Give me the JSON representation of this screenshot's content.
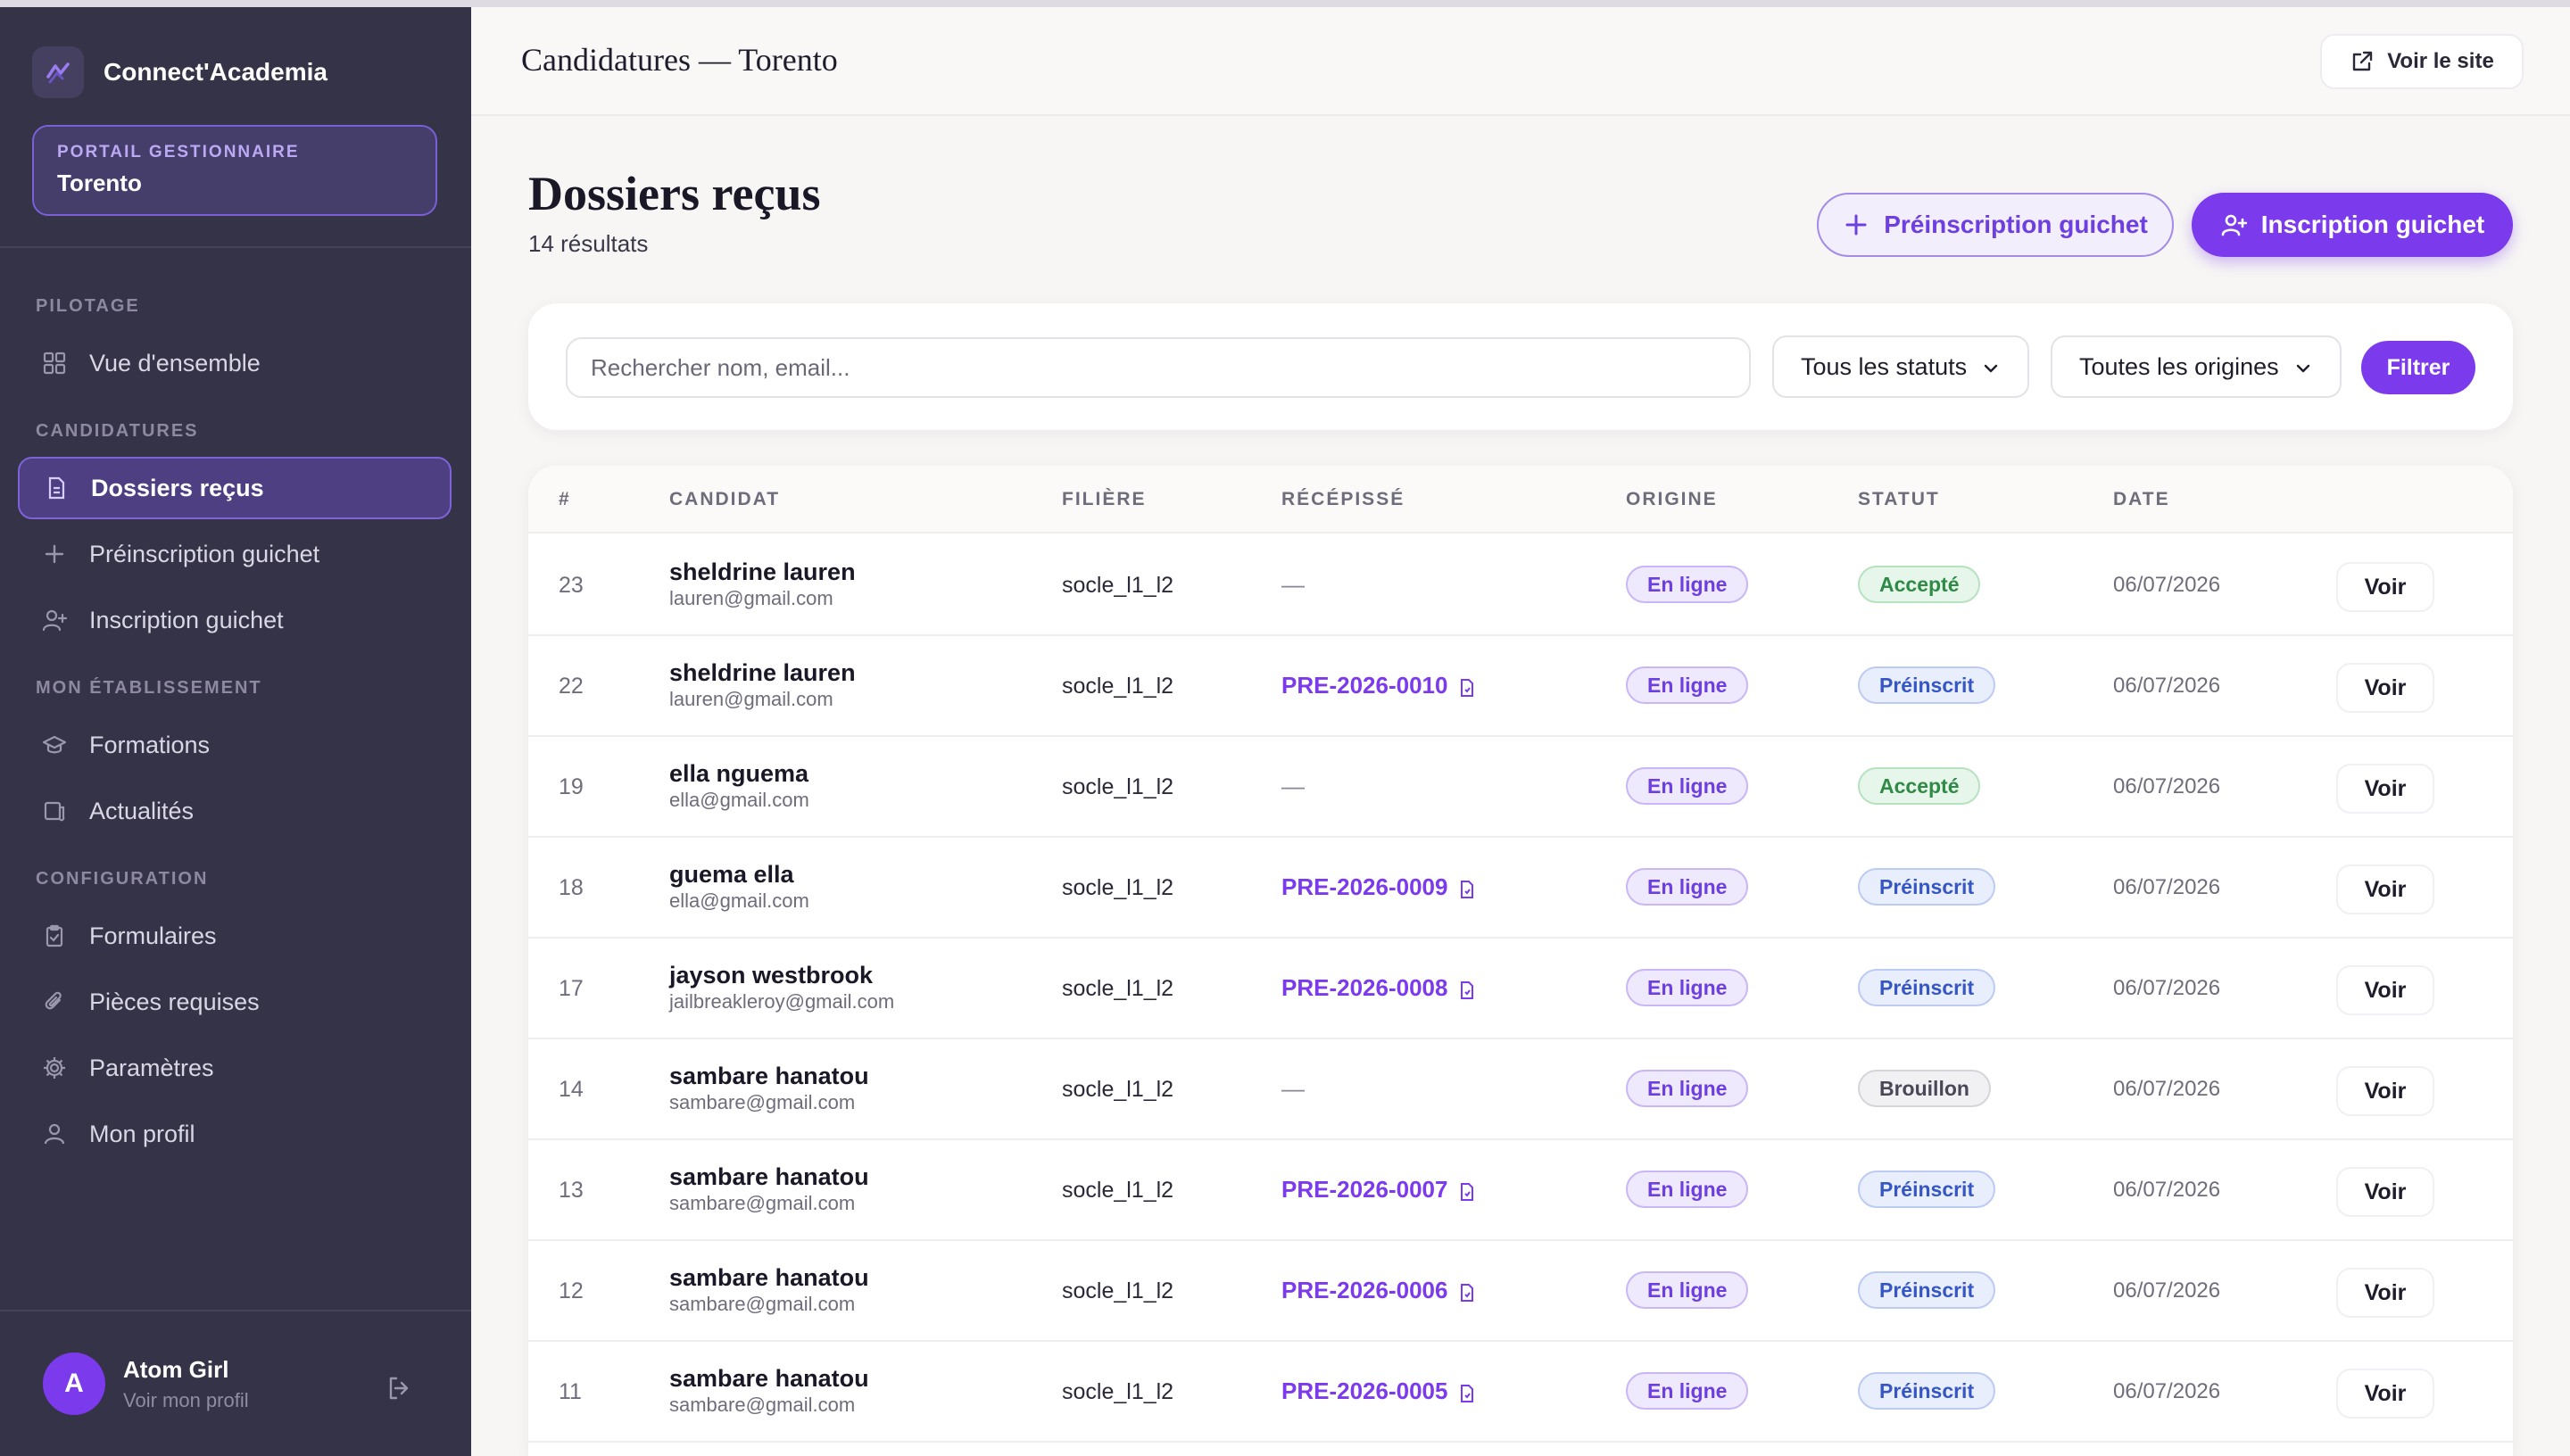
{
  "app": {
    "name": "Connect'Academia",
    "portal_label": "PORTAIL GESTIONNAIRE",
    "portal_value": "Torento"
  },
  "sidebar": {
    "sections": [
      {
        "label": "PILOTAGE",
        "items": [
          {
            "label": "Vue d'ensemble",
            "icon": "grid-icon"
          }
        ]
      },
      {
        "label": "CANDIDATURES",
        "items": [
          {
            "label": "Dossiers reçus",
            "icon": "document-icon",
            "active": true
          },
          {
            "label": "Préinscription guichet",
            "icon": "plus-icon"
          },
          {
            "label": "Inscription guichet",
            "icon": "user-plus-icon"
          }
        ]
      },
      {
        "label": "MON ÉTABLISSEMENT",
        "items": [
          {
            "label": "Formations",
            "icon": "graduation-cap-icon"
          },
          {
            "label": "Actualités",
            "icon": "news-icon"
          }
        ]
      },
      {
        "label": "CONFIGURATION",
        "items": [
          {
            "label": "Formulaires",
            "icon": "clipboard-icon"
          },
          {
            "label": "Pièces requises",
            "icon": "paperclip-icon"
          },
          {
            "label": "Paramètres",
            "icon": "gear-icon"
          },
          {
            "label": "Mon profil",
            "icon": "user-icon"
          }
        ]
      }
    ],
    "user": {
      "initial": "A",
      "name": "Atom Girl",
      "sub": "Voir mon profil"
    }
  },
  "header": {
    "title": "Candidatures — Torento",
    "site_button": "Voir le site"
  },
  "main": {
    "title": "Dossiers reçus",
    "count": "14 résultats",
    "btn_preinscription": "Préinscription guichet",
    "btn_inscription": "Inscription guichet",
    "search_placeholder": "Rechercher nom, email...",
    "status_filter": "Tous les statuts",
    "origin_filter": "Toutes les origines",
    "filter_button": "Filtrer"
  },
  "table": {
    "headers": [
      "#",
      "CANDIDAT",
      "FILIÈRE",
      "RÉCÉPISSÉ",
      "ORIGINE",
      "STATUT",
      "DATE"
    ],
    "action_label": "Voir",
    "rows": [
      {
        "id": "23",
        "name": "sheldrine lauren",
        "email": "lauren@gmail.com",
        "filiere": "socle_l1_l2",
        "recepisse": "—",
        "origin": "En ligne",
        "status": "Accepté",
        "status_kind": "accepte",
        "date": "06/07/2026"
      },
      {
        "id": "22",
        "name": "sheldrine lauren",
        "email": "lauren@gmail.com",
        "filiere": "socle_l1_l2",
        "recepisse": "PRE-2026-0010",
        "origin": "En ligne",
        "status": "Préinscrit",
        "status_kind": "preinscrit",
        "date": "06/07/2026"
      },
      {
        "id": "19",
        "name": "ella nguema",
        "email": "ella@gmail.com",
        "filiere": "socle_l1_l2",
        "recepisse": "—",
        "origin": "En ligne",
        "status": "Accepté",
        "status_kind": "accepte",
        "date": "06/07/2026"
      },
      {
        "id": "18",
        "name": "guema ella",
        "email": "ella@gmail.com",
        "filiere": "socle_l1_l2",
        "recepisse": "PRE-2026-0009",
        "origin": "En ligne",
        "status": "Préinscrit",
        "status_kind": "preinscrit",
        "date": "06/07/2026"
      },
      {
        "id": "17",
        "name": "jayson westbrook",
        "email": "jailbreakleroy@gmail.com",
        "filiere": "socle_l1_l2",
        "recepisse": "PRE-2026-0008",
        "origin": "En ligne",
        "status": "Préinscrit",
        "status_kind": "preinscrit",
        "date": "06/07/2026"
      },
      {
        "id": "14",
        "name": "sambare hanatou",
        "email": "sambare@gmail.com",
        "filiere": "socle_l1_l2",
        "recepisse": "—",
        "origin": "En ligne",
        "status": "Brouillon",
        "status_kind": "brouillon",
        "date": "06/07/2026"
      },
      {
        "id": "13",
        "name": "sambare hanatou",
        "email": "sambare@gmail.com",
        "filiere": "socle_l1_l2",
        "recepisse": "PRE-2026-0007",
        "origin": "En ligne",
        "status": "Préinscrit",
        "status_kind": "preinscrit",
        "date": "06/07/2026"
      },
      {
        "id": "12",
        "name": "sambare hanatou",
        "email": "sambare@gmail.com",
        "filiere": "socle_l1_l2",
        "recepisse": "PRE-2026-0006",
        "origin": "En ligne",
        "status": "Préinscrit",
        "status_kind": "preinscrit",
        "date": "06/07/2026"
      },
      {
        "id": "11",
        "name": "sambare hanatou",
        "email": "sambare@gmail.com",
        "filiere": "socle_l1_l2",
        "recepisse": "PRE-2026-0005",
        "origin": "En ligne",
        "status": "Préinscrit",
        "status_kind": "preinscrit",
        "date": "06/07/2026"
      }
    ]
  },
  "colors": {
    "accent": "#7c3aed",
    "sidebar_bg": "#353348",
    "page_bg": "#f7f6f4"
  }
}
